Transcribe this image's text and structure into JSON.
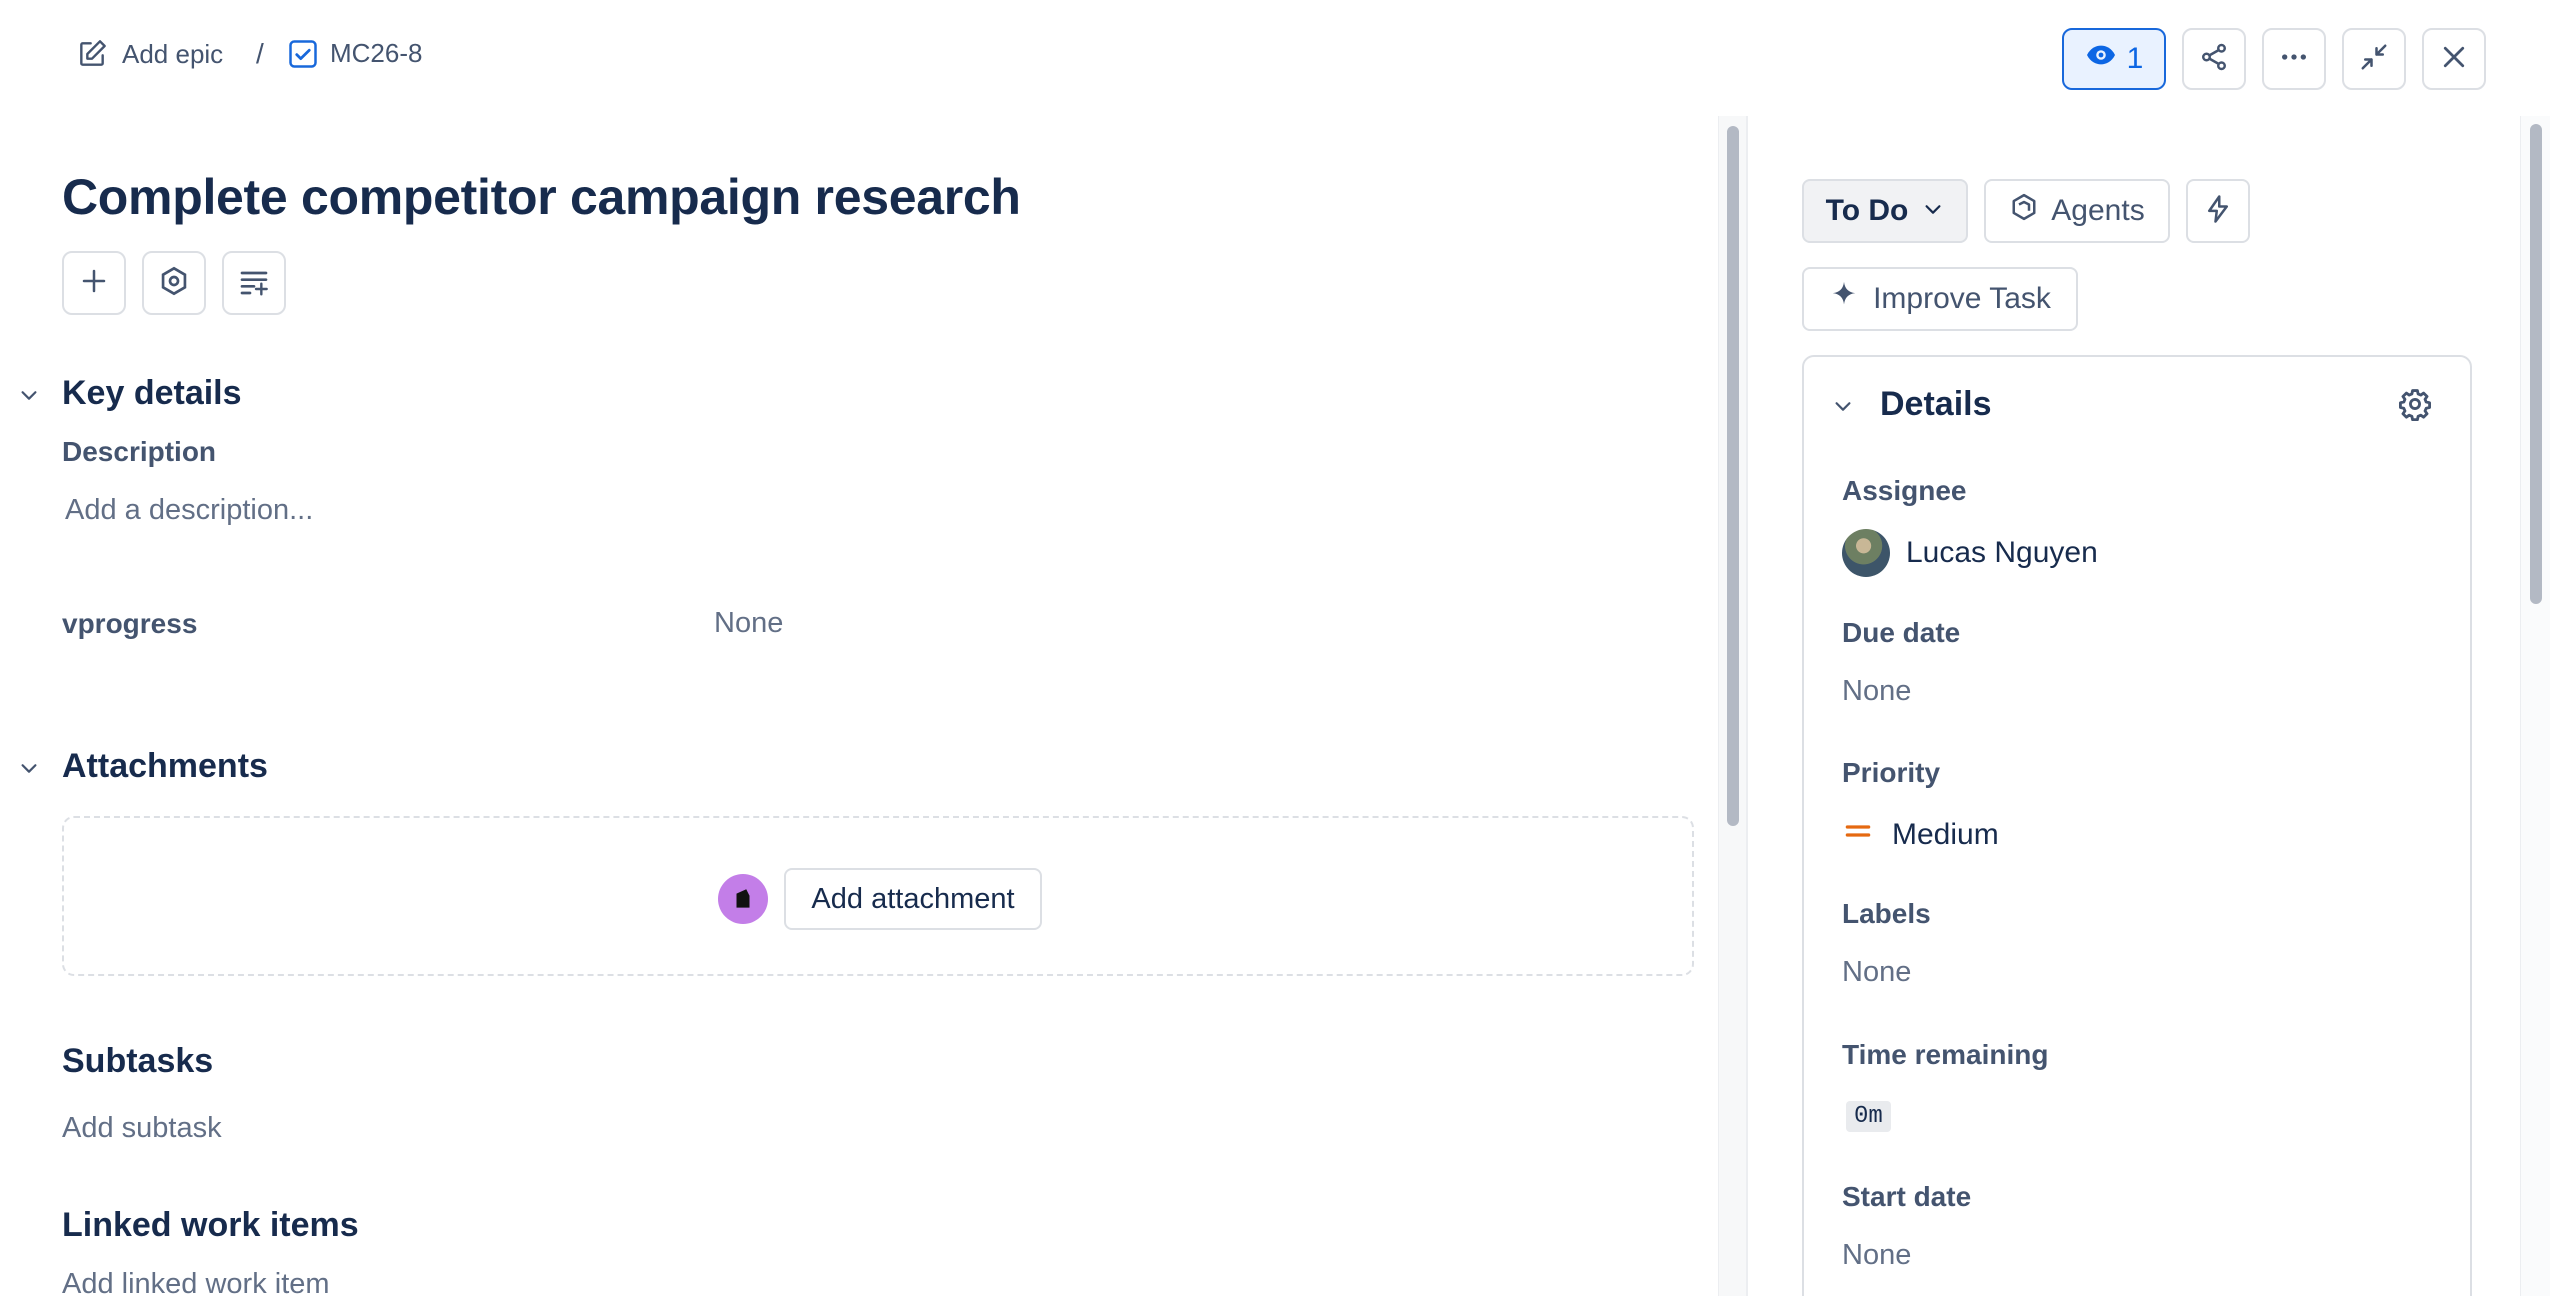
{
  "breadcrumb": {
    "add_epic": "Add epic",
    "separator": "/",
    "issue_key": "MC26-8"
  },
  "toolbar": {
    "watch_count": "1"
  },
  "issue": {
    "title": "Complete competitor campaign research"
  },
  "key_details": {
    "heading": "Key details",
    "description_label": "Description",
    "description_placeholder": "Add a description...",
    "vprogress_label": "vprogress",
    "vprogress_value": "None"
  },
  "attachments": {
    "heading": "Attachments",
    "add_button": "Add attachment"
  },
  "subtasks": {
    "heading": "Subtasks",
    "add": "Add subtask"
  },
  "linked": {
    "heading": "Linked work items",
    "add": "Add linked work item"
  },
  "side": {
    "status": "To Do",
    "agents": "Agents",
    "improve": "Improve Task"
  },
  "details": {
    "heading": "Details",
    "assignee_label": "Assignee",
    "assignee_name": "Lucas Nguyen",
    "due_label": "Due date",
    "due_value": "None",
    "priority_label": "Priority",
    "priority_value": "Medium",
    "labels_label": "Labels",
    "labels_value": "None",
    "time_label": "Time remaining",
    "time_value": "0m",
    "start_label": "Start date",
    "start_value": "None"
  },
  "colors": {
    "accent": "#0c66e4",
    "priority_medium": "#e56910"
  }
}
